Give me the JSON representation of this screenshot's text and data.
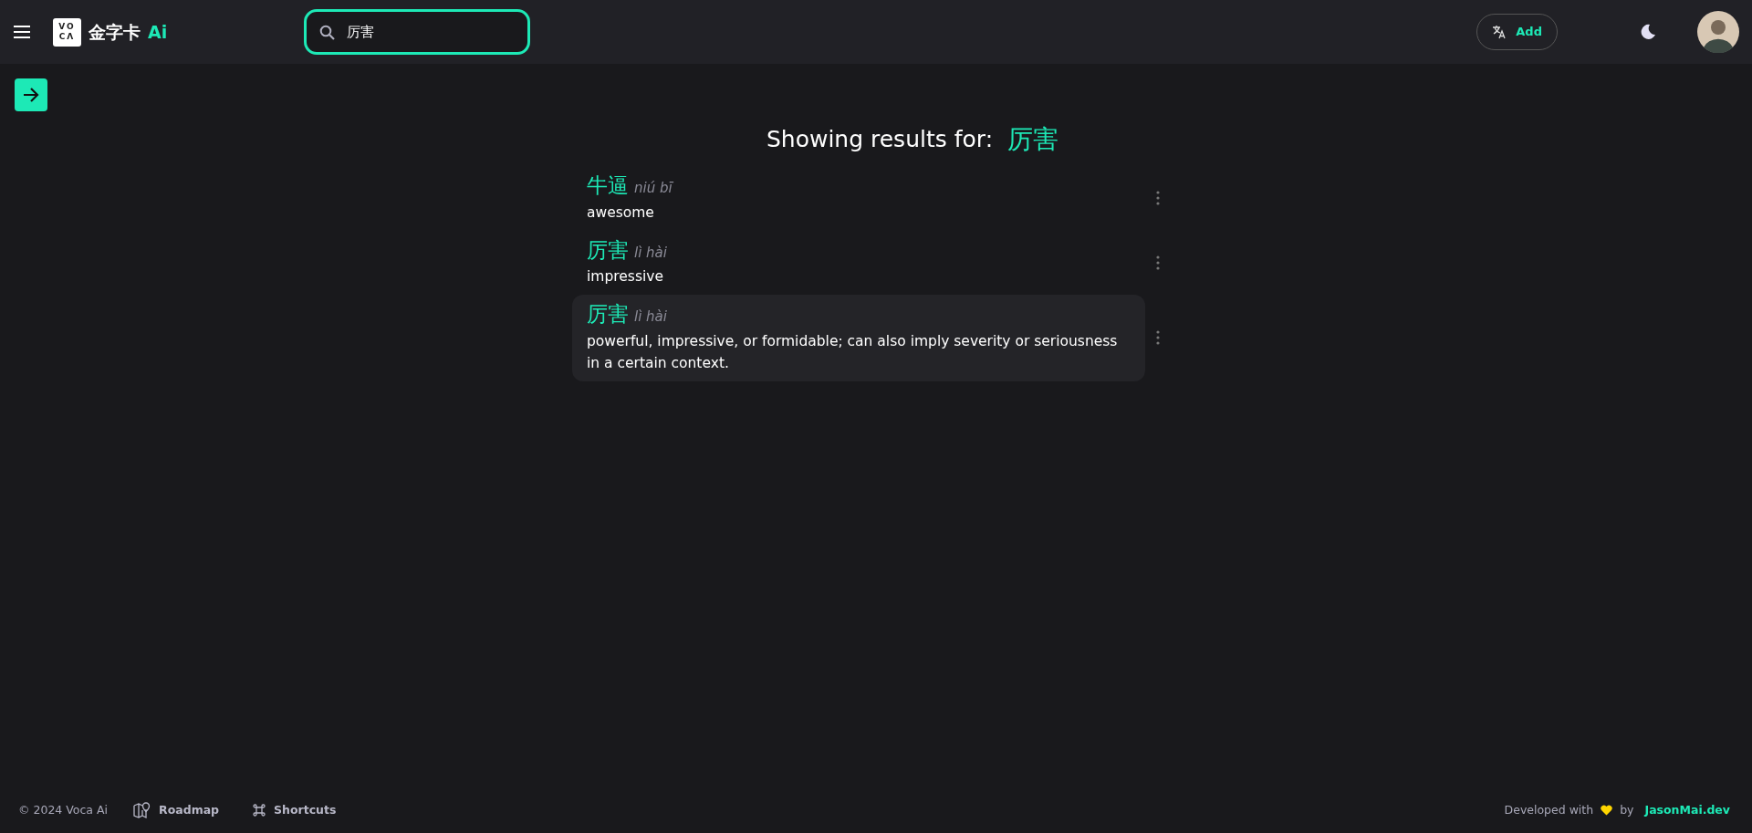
{
  "header": {
    "logo_mark": "VO CΛ",
    "logo_text": "金字卡",
    "logo_suffix": "Ai",
    "search": {
      "value": "厉害"
    },
    "add_button": "Add"
  },
  "heading": {
    "label": "Showing results for:",
    "query": "厉害"
  },
  "results": [
    {
      "word": "牛逼",
      "pinyin": "niú bī",
      "definition": "awesome",
      "selected": false
    },
    {
      "word": "厉害",
      "pinyin": "lì hài",
      "definition": "impressive",
      "selected": false
    },
    {
      "word": "厉害",
      "pinyin": "lì hài",
      "definition": "powerful, impressive, or formidable; can also imply severity or seriousness in a certain context.",
      "selected": true
    }
  ],
  "footer": {
    "copyright": "© 2024 Voca Ai",
    "links": [
      "Roadmap",
      "Shortcuts"
    ],
    "credit_prefix": "Developed with",
    "credit_by": "by",
    "credit_link": "JasonMai.dev"
  }
}
